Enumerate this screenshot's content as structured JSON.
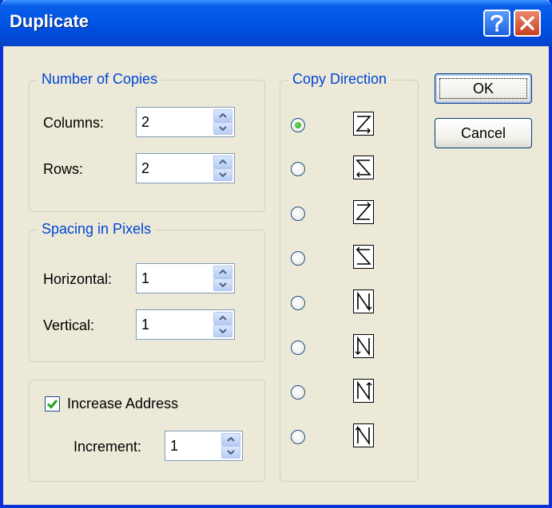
{
  "window": {
    "title": "Duplicate",
    "help_icon": "question-mark-icon",
    "close_icon": "close-x-icon"
  },
  "number_of_copies": {
    "legend": "Number of Copies",
    "columns_label": "Columns:",
    "columns_value": "2",
    "rows_label": "Rows:",
    "rows_value": "2"
  },
  "spacing": {
    "legend": "Spacing in Pixels",
    "horizontal_label": "Horizontal:",
    "horizontal_value": "1",
    "vertical_label": "Vertical:",
    "vertical_value": "1"
  },
  "address": {
    "checkbox_label": "Increase Address",
    "checked": true,
    "increment_label": "Increment:",
    "increment_value": "1"
  },
  "copy_direction": {
    "legend": "Copy Direction",
    "selected_index": 0,
    "options": [
      "z-right-down-icon",
      "s-left-down-icon",
      "s-right-down-icon",
      "z-left-down-icon",
      "n-down-right-icon",
      "n-down-left-icon",
      "n-up-right-icon",
      "n-up-left-icon"
    ]
  },
  "buttons": {
    "ok": "OK",
    "cancel": "Cancel"
  },
  "colors": {
    "title_bar": "#0055e5",
    "legend_text": "#0046d5",
    "dialog_bg": "#ece9d8"
  }
}
